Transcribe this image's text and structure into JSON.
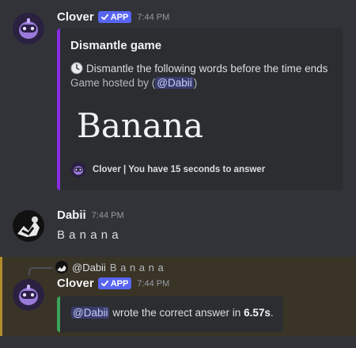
{
  "messages": [
    {
      "author": "Clover",
      "badge": "APP",
      "time": "7:44 PM",
      "embed": {
        "title": "Dismantle game",
        "clock_icon": "clock-icon",
        "description": "Dismantle the following words before the time ends",
        "hosted_prefix": "Game hosted by (",
        "hosted_mention": "@Dabii",
        "hosted_suffix": ")",
        "word": "Banana",
        "footer": "Clover | You have 15 seconds to answer",
        "accent": "#8a2be2"
      }
    },
    {
      "author": "Dabii",
      "time": "7:44 PM",
      "text": "B a n a n a"
    },
    {
      "reply_to": {
        "mention": "@Dabii",
        "text": "B a n a n a"
      },
      "author": "Clover",
      "badge": "APP",
      "time": "7:44 PM",
      "embed": {
        "mention": "@Dabii",
        "text_mid": "wrote the correct answer in",
        "time_value": "6.57s",
        "text_end": ".",
        "accent": "#3ba55c"
      }
    }
  ],
  "colors": {
    "background": "#313338",
    "embed_bg": "#2b2d31",
    "badge": "#5865f2",
    "highlight": "#3a3427",
    "highlight_border": "#b08a2c"
  }
}
